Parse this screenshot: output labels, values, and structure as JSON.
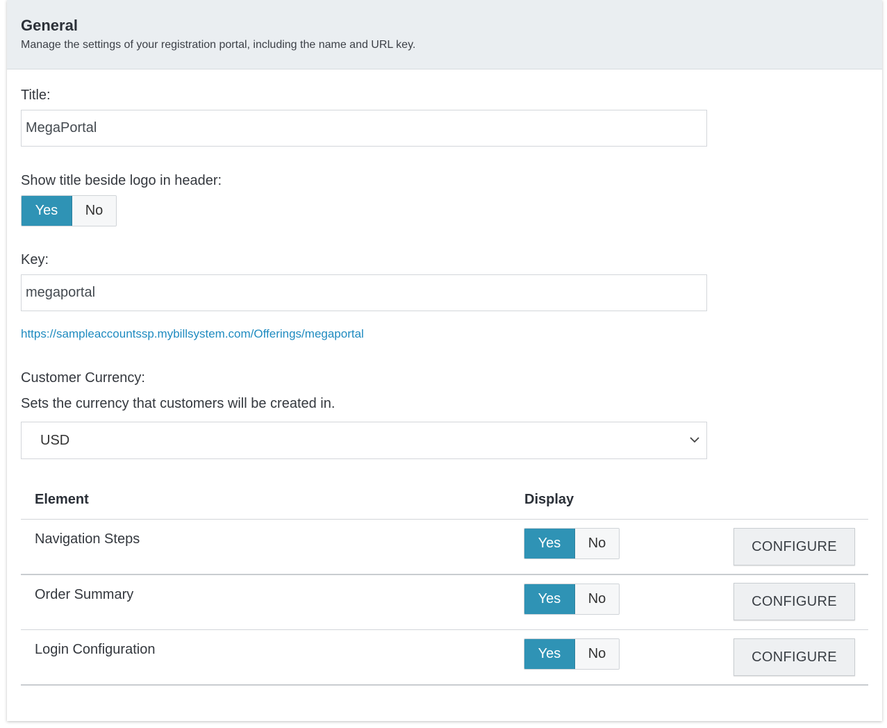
{
  "header": {
    "title": "General",
    "subtitle": "Manage the settings of your registration portal, including the name and URL key."
  },
  "title_field": {
    "label": "Title:",
    "value": "MegaPortal"
  },
  "show_title": {
    "label": "Show title beside logo in header:",
    "yes_label": "Yes",
    "no_label": "No",
    "selected": "Yes"
  },
  "key_field": {
    "label": "Key:",
    "value": "megaportal",
    "url": "https://sampleaccountssp.mybillsystem.com/Offerings/megaportal"
  },
  "currency": {
    "label": "Customer Currency:",
    "description": "Sets the currency that customers will be created in.",
    "selected": "USD"
  },
  "table": {
    "headers": {
      "element": "Element",
      "display": "Display"
    },
    "rows": [
      {
        "label": "Navigation Steps",
        "yes_label": "Yes",
        "no_label": "No",
        "selected": "Yes",
        "configure_label": "CONFIGURE"
      },
      {
        "label": "Order Summary",
        "yes_label": "Yes",
        "no_label": "No",
        "selected": "Yes",
        "configure_label": "CONFIGURE"
      },
      {
        "label": "Login Configuration",
        "yes_label": "Yes",
        "no_label": "No",
        "selected": "Yes",
        "configure_label": "CONFIGURE"
      }
    ]
  },
  "colors": {
    "accent": "#2f93b5",
    "link": "#1f8bc0",
    "header_bg": "#eaeef1"
  }
}
